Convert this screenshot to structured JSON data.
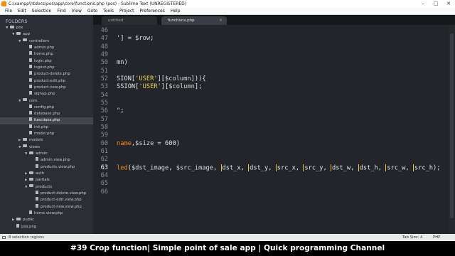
{
  "window": {
    "title": "C:\\xampp\\htdocs\\pos\\app\\core\\functions.php (pos) - Sublime Text (UNREGISTERED)",
    "controls": [
      "–",
      "□",
      "✕"
    ]
  },
  "menu": [
    "File",
    "Edit",
    "Selection",
    "Find",
    "View",
    "Goto",
    "Tools",
    "Project",
    "Preferences",
    "Help"
  ],
  "sidebar": {
    "title": "FOLDERS",
    "tree": [
      {
        "label": "pos",
        "kind": "folder",
        "depth": 0,
        "open": true
      },
      {
        "label": "app",
        "kind": "folder",
        "depth": 1,
        "open": true
      },
      {
        "label": "controllers",
        "kind": "folder",
        "depth": 2,
        "open": true
      },
      {
        "label": "admin.php",
        "kind": "file",
        "depth": 3
      },
      {
        "label": "home.php",
        "kind": "file",
        "depth": 3
      },
      {
        "label": "login.php",
        "kind": "file",
        "depth": 3
      },
      {
        "label": "logout.php",
        "kind": "file",
        "depth": 3
      },
      {
        "label": "product-delete.php",
        "kind": "file",
        "depth": 3
      },
      {
        "label": "product-edit.php",
        "kind": "file",
        "depth": 3
      },
      {
        "label": "product-new.php",
        "kind": "file",
        "depth": 3
      },
      {
        "label": "signup.php",
        "kind": "file",
        "depth": 3
      },
      {
        "label": "core",
        "kind": "folder",
        "depth": 2,
        "open": true
      },
      {
        "label": "config.php",
        "kind": "file",
        "depth": 3
      },
      {
        "label": "database.php",
        "kind": "file",
        "depth": 3
      },
      {
        "label": "functions.php",
        "kind": "file",
        "depth": 3,
        "selected": true
      },
      {
        "label": "init.php",
        "kind": "file",
        "depth": 3
      },
      {
        "label": "model.php",
        "kind": "file",
        "depth": 3
      },
      {
        "label": "models",
        "kind": "folder",
        "depth": 2,
        "open": false
      },
      {
        "label": "views",
        "kind": "folder",
        "depth": 2,
        "open": true
      },
      {
        "label": "admin",
        "kind": "folder",
        "depth": 3,
        "open": true
      },
      {
        "label": "admin.view.php",
        "kind": "file",
        "depth": 4
      },
      {
        "label": "products.view.php",
        "kind": "file",
        "depth": 4
      },
      {
        "label": "auth",
        "kind": "folder",
        "depth": 3,
        "open": false
      },
      {
        "label": "partials",
        "kind": "folder",
        "depth": 3,
        "open": false
      },
      {
        "label": "products",
        "kind": "folder",
        "depth": 3,
        "open": true
      },
      {
        "label": "product-delete.view.php",
        "kind": "file",
        "depth": 4
      },
      {
        "label": "product-edit.view.php",
        "kind": "file",
        "depth": 4
      },
      {
        "label": "product-new.view.php",
        "kind": "file",
        "depth": 4
      },
      {
        "label": "home.view.php",
        "kind": "file",
        "depth": 3
      },
      {
        "label": "public",
        "kind": "folder",
        "depth": 1,
        "open": false
      },
      {
        "label": "pos.png",
        "kind": "file",
        "depth": 1
      }
    ]
  },
  "tabs": [
    {
      "label": "untitled",
      "active": false
    },
    {
      "label": "functions.php",
      "active": true
    }
  ],
  "editor": {
    "lines": [
      {
        "num": "46",
        "code": ""
      },
      {
        "num": "47",
        "code": "'] = $row;"
      },
      {
        "num": "48",
        "code": ""
      },
      {
        "num": "49",
        "code": ""
      },
      {
        "num": "50",
        "code": "mn)"
      },
      {
        "num": "51",
        "code": ""
      },
      {
        "num": "52",
        "code": "SION['USER'][$column])){"
      },
      {
        "num": "53",
        "code": "SSION['USER'][$column];"
      },
      {
        "num": "54",
        "code": ""
      },
      {
        "num": "55",
        "code": ""
      },
      {
        "num": "56",
        "code": "\";"
      },
      {
        "num": "57",
        "code": ""
      },
      {
        "num": "58",
        "code": ""
      },
      {
        "num": "59",
        "code": ""
      },
      {
        "num": "60",
        "code": "name,$size = 600)"
      },
      {
        "num": "61",
        "code": ""
      },
      {
        "num": "62",
        "code": ""
      },
      {
        "num": "63",
        "code": "led($dst_image, $src_image, |dst_x, |dst_y, |src_x, |src_y, |dst_w, |dst_h, |src_w, |src_h);",
        "current": true
      },
      {
        "num": "64",
        "code": ""
      },
      {
        "num": "65",
        "code": ""
      },
      {
        "num": "66",
        "code": ""
      }
    ]
  },
  "status": {
    "selection": "8 selection regions",
    "tab_size": "Tab Size: 4",
    "syntax": "PHP"
  },
  "caption": "#39 Crop function| Simple point of sale app | Quick programming Channel",
  "colors": {
    "accent": "#f28a1a",
    "string": "#f0d45a",
    "editor_bg": "#23252a",
    "sidebar_bg": "#2b2e33"
  }
}
